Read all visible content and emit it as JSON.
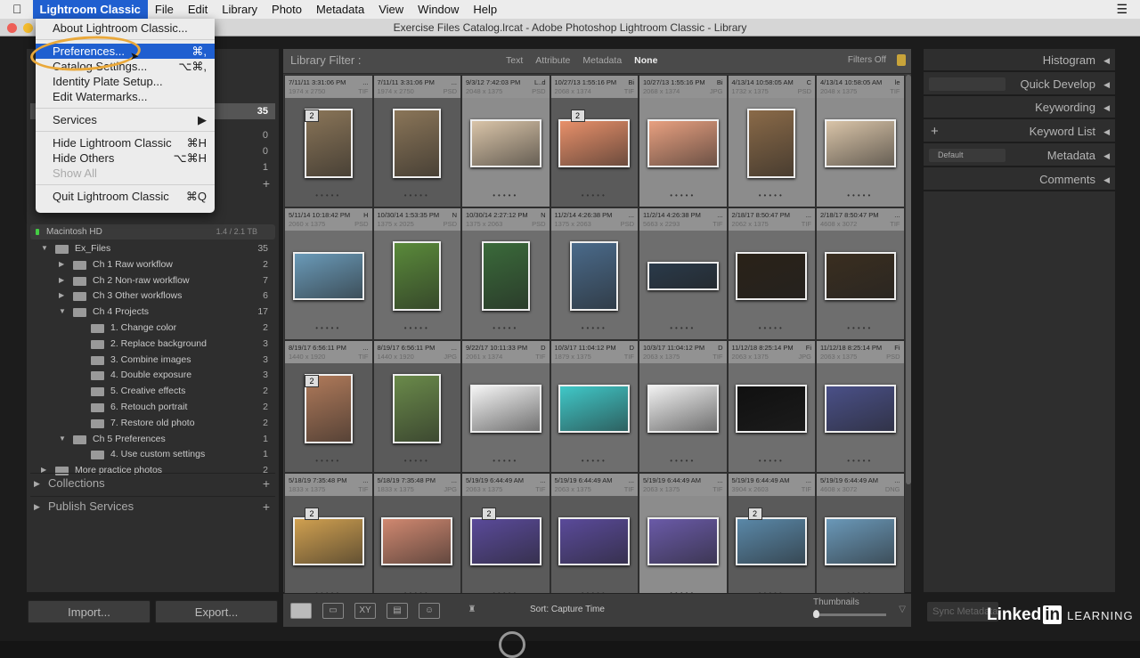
{
  "menubar": {
    "apple": "",
    "app": "Lightroom Classic",
    "items": [
      "File",
      "Edit",
      "Library",
      "Photo",
      "Metadata",
      "View",
      "Window",
      "Help"
    ],
    "right_icon": "list-icon"
  },
  "window": {
    "title": "Exercise Files Catalog.lrcat - Adobe Photoshop Lightroom Classic - Library",
    "traffic": [
      "#ee5f57",
      "#f5bd2f"
    ]
  },
  "app_menu": {
    "items": [
      {
        "label": "About Lightroom Classic...",
        "shortcut": ""
      },
      {
        "sep": true
      },
      {
        "label": "Preferences...",
        "shortcut": "⌘,",
        "highlight": true
      },
      {
        "label": "Catalog Settings...",
        "shortcut": "⌥⌘,"
      },
      {
        "label": "Identity Plate Setup...",
        "shortcut": ""
      },
      {
        "label": "Edit Watermarks...",
        "shortcut": ""
      },
      {
        "sep": true
      },
      {
        "label": "Services",
        "shortcut": "▶"
      },
      {
        "sep": true
      },
      {
        "label": "Hide Lightroom Classic",
        "shortcut": "⌘H"
      },
      {
        "label": "Hide Others",
        "shortcut": "⌥⌘H"
      },
      {
        "label": "Show All",
        "shortcut": "",
        "disabled": true
      },
      {
        "sep": true
      },
      {
        "label": "Quit Lightroom Classic",
        "shortcut": "⌘Q"
      }
    ]
  },
  "catalog_counts": [
    "35",
    "0",
    "0",
    "1"
  ],
  "volume": {
    "name": "Macintosh HD",
    "size": "1.4 / 2.1 TB"
  },
  "folders": [
    {
      "label": "Ex_Files",
      "count": "35",
      "level": 0,
      "open": true
    },
    {
      "label": "Ch 1 Raw workflow",
      "count": "2",
      "level": 1,
      "open": false
    },
    {
      "label": "Ch 2 Non-raw workflow",
      "count": "7",
      "level": 1,
      "open": false
    },
    {
      "label": "Ch 3 Other workflows",
      "count": "6",
      "level": 1,
      "open": false
    },
    {
      "label": "Ch 4 Projects",
      "count": "17",
      "level": 1,
      "open": true
    },
    {
      "label": "1. Change color",
      "count": "2",
      "level": 2
    },
    {
      "label": "2. Replace background",
      "count": "3",
      "level": 2
    },
    {
      "label": "3. Combine images",
      "count": "3",
      "level": 2
    },
    {
      "label": "4. Double exposure",
      "count": "3",
      "level": 2
    },
    {
      "label": "5. Creative effects",
      "count": "2",
      "level": 2
    },
    {
      "label": "6. Retouch portrait",
      "count": "2",
      "level": 2
    },
    {
      "label": "7. Restore old photo",
      "count": "2",
      "level": 2
    },
    {
      "label": "Ch 5 Preferences",
      "count": "1",
      "level": 1,
      "open": true
    },
    {
      "label": "4. Use custom settings",
      "count": "1",
      "level": 2
    },
    {
      "label": "More practice photos",
      "count": "2",
      "level": 0,
      "open": false
    }
  ],
  "left_sections": {
    "collections": "Collections",
    "publish": "Publish Services"
  },
  "buttons": {
    "import": "Import...",
    "export": "Export..."
  },
  "filter": {
    "title": "Library Filter :",
    "options": [
      "Text",
      "Attribute",
      "Metadata",
      "None"
    ],
    "selected": "None",
    "status": "Filters Off"
  },
  "grid": [
    {
      "date": "7/11/11 3:31:06 PM",
      "flag": "...",
      "dims": "1974 x 2750",
      "ext": "TIF",
      "badge": "2",
      "shape": "portrait",
      "color": "#8a7558",
      "tone": "dk"
    },
    {
      "date": "7/11/11 3:31:06 PM",
      "flag": "...",
      "dims": "1974 x 2750",
      "ext": "PSD",
      "badge": "",
      "shape": "portrait",
      "color": "#8a7558",
      "tone": "dk"
    },
    {
      "date": "9/3/12 7:42:03 PM",
      "flag": "L..d",
      "dims": "2048 x 1375",
      "ext": "PSD",
      "badge": "",
      "shape": "landscape",
      "color": "#d9c4a8",
      "tone": "lt"
    },
    {
      "date": "10/27/13 1:55:16 PM",
      "flag": "Bi",
      "dims": "2068 x 1374",
      "ext": "TIF",
      "badge": "2",
      "shape": "landscape",
      "color": "#e8906a",
      "tone": "dk"
    },
    {
      "date": "10/27/13 1:55:16 PM",
      "flag": "Bi",
      "dims": "2068 x 1374",
      "ext": "JPG",
      "badge": "",
      "shape": "landscape",
      "color": "#e8a080",
      "tone": "lt"
    },
    {
      "date": "4/13/14 10:58:05 AM",
      "flag": "C",
      "dims": "1732 x 1375",
      "ext": "PSD",
      "badge": "",
      "shape": "portrait",
      "color": "#8a6a48",
      "tone": "lt"
    },
    {
      "date": "4/13/14 10:58:05 AM",
      "flag": "le",
      "dims": "2048 x 1375",
      "ext": "TIF",
      "badge": "",
      "shape": "landscape",
      "color": "#d9c4a8",
      "tone": "lt"
    },
    {
      "date": "5/11/14 10:18:42 PM",
      "flag": "H",
      "dims": "2060 x 1375",
      "ext": "PSD",
      "badge": "",
      "shape": "landscape",
      "color": "#6a9ab8",
      "tone": ""
    },
    {
      "date": "10/30/14 1:53:35 PM",
      "flag": "N",
      "dims": "1375 x 2025",
      "ext": "PSD",
      "badge": "",
      "shape": "portrait",
      "color": "#5a8a3a",
      "tone": ""
    },
    {
      "date": "10/30/14 2:27:12 PM",
      "flag": "N",
      "dims": "1375 x 2063",
      "ext": "PSD",
      "badge": "",
      "shape": "portrait",
      "color": "#3a6a3a",
      "tone": ""
    },
    {
      "date": "11/2/14 4:26:38 PM",
      "flag": "...",
      "dims": "1375 x 2063",
      "ext": "PSD",
      "badge": "",
      "shape": "portrait",
      "color": "#4a6a8a",
      "tone": ""
    },
    {
      "date": "11/2/14 4:26:38 PM",
      "flag": "...",
      "dims": "5663 x 2293",
      "ext": "TIF",
      "badge": "",
      "shape": "pano",
      "color": "#2a3a4a",
      "tone": ""
    },
    {
      "date": "2/18/17 8:50:47 PM",
      "flag": "...",
      "dims": "2062 x 1375",
      "ext": "TIF",
      "badge": "",
      "shape": "landscape",
      "color": "#2a2218",
      "tone": ""
    },
    {
      "date": "2/18/17 8:50:47 PM",
      "flag": "...",
      "dims": "4608 x 3072",
      "ext": "TIF",
      "badge": "",
      "shape": "landscape",
      "color": "#3a2e20",
      "tone": ""
    },
    {
      "date": "8/19/17 6:56:11 PM",
      "flag": "...",
      "dims": "1440 x 1920",
      "ext": "TIF",
      "badge": "2",
      "shape": "portrait",
      "color": "#b07a5a",
      "tone": "dk"
    },
    {
      "date": "8/19/17 6:56:11 PM",
      "flag": "...",
      "dims": "1440 x 1920",
      "ext": "JPG",
      "badge": "",
      "shape": "portrait",
      "color": "#6a8a4a",
      "tone": "dk"
    },
    {
      "date": "9/22/17 10:11:33 PM",
      "flag": "D",
      "dims": "2061 x 1374",
      "ext": "TIF",
      "badge": "",
      "shape": "landscape",
      "color": "#f4f4f4",
      "tone": ""
    },
    {
      "date": "10/3/17 11:04:12 PM",
      "flag": "D",
      "dims": "1879 x 1375",
      "ext": "TIF",
      "badge": "",
      "shape": "landscape",
      "color": "#40c8c8",
      "tone": ""
    },
    {
      "date": "10/3/17 11:04:12 PM",
      "flag": "D",
      "dims": "2063 x 1375",
      "ext": "TIF",
      "badge": "",
      "shape": "landscape",
      "color": "#f0f0f0",
      "tone": ""
    },
    {
      "date": "11/12/18 8:25:14 PM",
      "flag": "Fi",
      "dims": "2063 x 1375",
      "ext": "JPG",
      "badge": "",
      "shape": "landscape",
      "color": "#101010",
      "tone": ""
    },
    {
      "date": "11/12/18 8:25:14 PM",
      "flag": "Fi",
      "dims": "2063 x 1375",
      "ext": "PSD",
      "badge": "",
      "shape": "landscape",
      "color": "#4a5088",
      "tone": ""
    },
    {
      "date": "5/18/19 7:35:48 PM",
      "flag": "...",
      "dims": "1833 x 1375",
      "ext": "TIF",
      "badge": "2",
      "shape": "landscape",
      "color": "#d0a050",
      "tone": "dk"
    },
    {
      "date": "5/18/19 7:35:48 PM",
      "flag": "...",
      "dims": "1833 x 1375",
      "ext": "JPG",
      "badge": "",
      "shape": "landscape",
      "color": "#d08870",
      "tone": "dk"
    },
    {
      "date": "5/19/19 6:44:49 AM",
      "flag": "...",
      "dims": "2063 x 1375",
      "ext": "TIF",
      "badge": "2",
      "shape": "landscape",
      "color": "#5a4a9a",
      "tone": "dk"
    },
    {
      "date": "5/19/19 6:44:49 AM",
      "flag": "...",
      "dims": "2063 x 1375",
      "ext": "TIF",
      "badge": "",
      "shape": "landscape",
      "color": "#5a4a9a",
      "tone": "dk"
    },
    {
      "date": "5/19/19 6:44:49 AM",
      "flag": "...",
      "dims": "2063 x 1375",
      "ext": "TIF",
      "badge": "",
      "shape": "landscape",
      "color": "#6a5aa8",
      "tone": "lt"
    },
    {
      "date": "5/19/19 6:44:49 AM",
      "flag": "...",
      "dims": "3904 x 2603",
      "ext": "TIF",
      "badge": "2",
      "shape": "landscape",
      "color": "#5a88a8",
      "tone": "dk"
    },
    {
      "date": "5/19/19 6:44:49 AM",
      "flag": "...",
      "dims": "4608 x 3072",
      "ext": "DNG",
      "badge": "",
      "shape": "landscape",
      "color": "#6a98b8",
      "tone": "dk"
    }
  ],
  "toolbar": {
    "sort_label": "Sort:",
    "sort_value": "Capture Time",
    "thumbnails_label": "Thumbnails",
    "thumbnail_size_fraction": 0.05
  },
  "right_panels": [
    {
      "label": "Histogram",
      "control": ""
    },
    {
      "label": "Quick Develop",
      "control": " "
    },
    {
      "label": "Keywording",
      "control": ""
    },
    {
      "label": "Keyword List",
      "control": "+"
    },
    {
      "label": "Metadata",
      "control": "Default"
    },
    {
      "label": "Comments",
      "control": ""
    }
  ],
  "sync": {
    "label": "Sync Metadata"
  },
  "branding": {
    "linked": "Linked",
    "in": "in",
    "learning": "LEARNING"
  }
}
